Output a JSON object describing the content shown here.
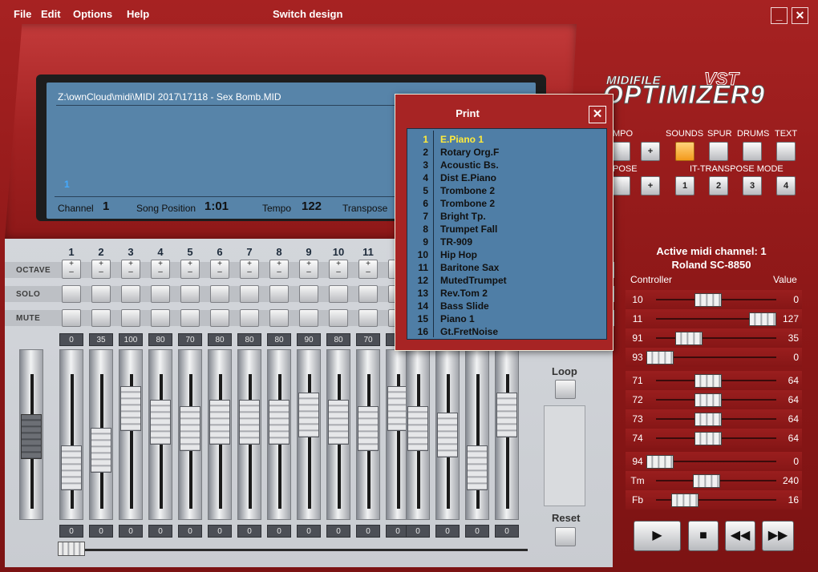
{
  "menu": {
    "file": "File",
    "edit": "Edit",
    "options": "Options",
    "help": "Help",
    "switch_design": "Switch design"
  },
  "window": {
    "minimize": "_",
    "close": "✕"
  },
  "display": {
    "file_path": "Z:\\ownCloud\\midi\\MIDI 2017\\17118 - Sex Bomb.MID",
    "cursor_number": "1",
    "channel_label": "Channel",
    "channel_value": "1",
    "song_pos_label": "Song Position",
    "song_pos_value": "1:01",
    "tempo_label": "Tempo",
    "tempo_value": "122",
    "transpose_label": "Transpose"
  },
  "mixer": {
    "row_labels": {
      "octave": "OCTAVE",
      "solo": "SOLO",
      "mute": "MUTE"
    },
    "octave_plus": "+",
    "octave_minus": "–",
    "channels": [
      {
        "num": "1",
        "top": "0",
        "bottom": "0",
        "level": 0.25
      },
      {
        "num": "2",
        "top": "35",
        "bottom": "0",
        "level": 0.41
      },
      {
        "num": "3",
        "top": "100",
        "bottom": "0",
        "level": 0.78
      },
      {
        "num": "4",
        "top": "80",
        "bottom": "0",
        "level": 0.66
      },
      {
        "num": "5",
        "top": "70",
        "bottom": "0",
        "level": 0.6
      },
      {
        "num": "6",
        "top": "80",
        "bottom": "0",
        "level": 0.66
      },
      {
        "num": "7",
        "top": "80",
        "bottom": "0",
        "level": 0.66
      },
      {
        "num": "8",
        "top": "80",
        "bottom": "0",
        "level": 0.66
      },
      {
        "num": "9",
        "top": "90",
        "bottom": "0",
        "level": 0.72
      },
      {
        "num": "10",
        "top": "80",
        "bottom": "0",
        "level": 0.66
      },
      {
        "num": "11",
        "top": "70",
        "bottom": "0",
        "level": 0.6
      },
      {
        "num": "1",
        "top": "1",
        "bottom": "0",
        "level": 0.78
      },
      {
        "num": "",
        "top": "",
        "bottom": "0",
        "level": 0.6
      },
      {
        "num": "",
        "top": "",
        "bottom": "0",
        "level": 0.54
      },
      {
        "num": "",
        "top": "",
        "bottom": "0",
        "level": 0.25
      },
      {
        "num": "",
        "top": "",
        "bottom": "0",
        "level": 0.72
      }
    ],
    "loop_label": "Loop",
    "reset_label": "Reset"
  },
  "logo": {
    "top": "MIDIFILE",
    "vst": "VST",
    "main": "OPTIMIZER9"
  },
  "modes": {
    "tempo_label": "MPO",
    "sounds_label": "SOUNDS",
    "spur_label": "SPUR",
    "drums_label": "DRUMS",
    "text_label": "TEXT",
    "transpose_label": "POSE",
    "mode_label": "IT-TRANSPOSE MODE",
    "plus": "+",
    "m1": "1",
    "m2": "2",
    "m3": "3",
    "m4": "4"
  },
  "controllers": {
    "title": "Active midi channel: 1",
    "device": "Roland SC-8850",
    "head_controller": "Controller",
    "head_value": "Value",
    "rows": [
      {
        "cc": "10",
        "value": "0",
        "level": 0.47
      },
      {
        "cc": "11",
        "value": "127",
        "level": 1.0
      },
      {
        "cc": "91",
        "value": "35",
        "level": 0.28
      },
      {
        "cc": "93",
        "value": "0",
        "level": 0.0
      },
      {
        "cc": "71",
        "value": "64",
        "level": 0.47
      },
      {
        "cc": "72",
        "value": "64",
        "level": 0.47
      },
      {
        "cc": "73",
        "value": "64",
        "level": 0.47
      },
      {
        "cc": "74",
        "value": "64",
        "level": 0.47
      },
      {
        "cc": "94",
        "value": "0",
        "level": 0.0
      },
      {
        "cc": "Tm",
        "value": "240",
        "level": 0.45
      },
      {
        "cc": "Fb",
        "value": "16",
        "level": 0.24
      }
    ]
  },
  "transport": {
    "play": "▶",
    "stop": "■",
    "rewind": "◀◀",
    "forward": "▶▶"
  },
  "print_popup": {
    "title": "Print",
    "close": "✕",
    "items": [
      {
        "num": "1",
        "name": "E.Piano 1"
      },
      {
        "num": "2",
        "name": "Rotary Org.F"
      },
      {
        "num": "3",
        "name": "Acoustic Bs."
      },
      {
        "num": "4",
        "name": "Dist E.Piano"
      },
      {
        "num": "5",
        "name": "Trombone 2"
      },
      {
        "num": "6",
        "name": "Trombone 2"
      },
      {
        "num": "7",
        "name": "Bright Tp."
      },
      {
        "num": "8",
        "name": "Trumpet Fall"
      },
      {
        "num": "9",
        "name": "TR-909"
      },
      {
        "num": "10",
        "name": "Hip Hop"
      },
      {
        "num": "11",
        "name": "Baritone Sax"
      },
      {
        "num": "12",
        "name": "MutedTrumpet"
      },
      {
        "num": "13",
        "name": "Rev.Tom 2"
      },
      {
        "num": "14",
        "name": "Bass Slide"
      },
      {
        "num": "15",
        "name": "Piano 1"
      },
      {
        "num": "16",
        "name": "Gt.FretNoise"
      }
    ]
  }
}
